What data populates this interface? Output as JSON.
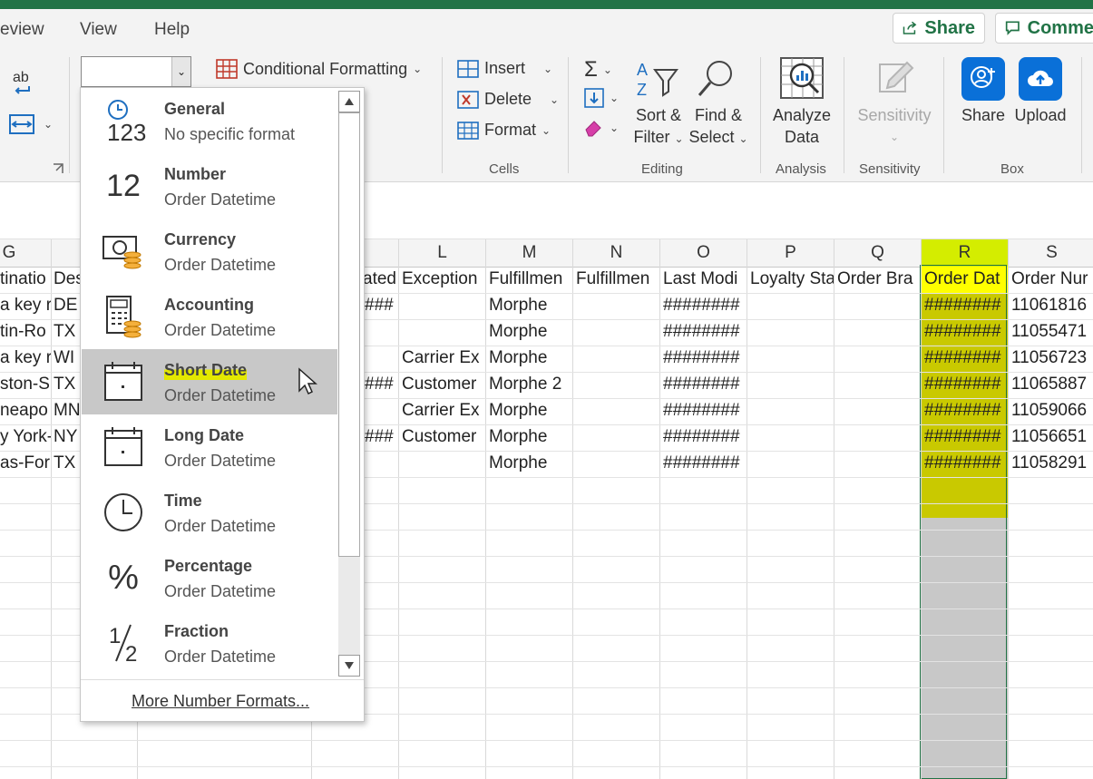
{
  "menu": {
    "review": "eview",
    "view": "View",
    "help": "Help"
  },
  "actions": {
    "share": "Share",
    "comments": "Comme"
  },
  "ribbon": {
    "wrap_icon_text": "ab",
    "conditional_formatting": "Conditional Formatting",
    "cells": {
      "insert": "Insert",
      "delete": "Delete",
      "format": "Format",
      "group": "Cells"
    },
    "editing": {
      "sort_filter_1": "Sort &",
      "sort_filter_2": "Filter",
      "find_select_1": "Find &",
      "find_select_2": "Select",
      "group": "Editing"
    },
    "analysis": {
      "analyze_1": "Analyze",
      "analyze_2": "Data",
      "group": "Analysis"
    },
    "sensitivity": {
      "label": "Sensitivity",
      "group": "Sensitivity"
    },
    "box": {
      "share": "Share",
      "upload": "Upload",
      "group": "Box"
    },
    "number_format_value": ""
  },
  "columns": {
    "G": "G",
    "L": "L",
    "M": "M",
    "N": "N",
    "O": "O",
    "P": "P",
    "Q": "Q",
    "R": "R",
    "S": "S"
  },
  "headers": {
    "g": "tinatio",
    "h": "Des",
    "k": "ated",
    "l": "Exception",
    "m": "Fulfillmen",
    "n": "Fulfillmen",
    "o": "Last Modi",
    "p": "Loyalty Sta",
    "q": "Order Bra",
    "r": "Order Dat",
    "s": "Order Nur"
  },
  "rows": [
    {
      "g": "a key r",
      "h": "DE",
      "k": "###",
      "l": "",
      "m": "Morphe",
      "o": "########",
      "r": "########",
      "s": "11061816"
    },
    {
      "g": "tin-Ro",
      "h": "TX",
      "k": "",
      "l": "",
      "m": "Morphe",
      "o": "########",
      "r": "########",
      "s": "11055471"
    },
    {
      "g": "a key r",
      "h": "WI",
      "k": "",
      "l": "Carrier Ex",
      "m": "Morphe",
      "o": "########",
      "r": "########",
      "s": "11056723"
    },
    {
      "g": "ston-S",
      "h": "TX",
      "k": "###",
      "l": "Customer",
      "m": "Morphe 2",
      "o": "########",
      "r": "########",
      "s": "11065887"
    },
    {
      "g": "neapo",
      "h": "MN",
      "k": "",
      "l": "Carrier Ex",
      "m": "Morphe",
      "o": "########",
      "r": "########",
      "s": "11059066"
    },
    {
      "g": "y York-",
      "h": "NY",
      "k": "###",
      "l": "Customer",
      "m": "Morphe",
      "o": "########",
      "r": "########",
      "s": "11056651"
    },
    {
      "g": "as-For",
      "h": "TX",
      "k": "",
      "l": "",
      "m": "Morphe",
      "o": "########",
      "r": "########",
      "s": "11058291"
    }
  ],
  "number_formats": [
    {
      "title": "General",
      "sub": "No specific format",
      "icon": "clock-123-icon"
    },
    {
      "title": "Number",
      "sub": "Order Datetime",
      "icon": "number-12-icon"
    },
    {
      "title": "Currency",
      "sub": "Order Datetime",
      "icon": "currency-icon"
    },
    {
      "title": "Accounting",
      "sub": " Order Datetime",
      "icon": "calculator-icon"
    },
    {
      "title": "Short Date",
      "sub": "Order Datetime",
      "icon": "calendar-icon"
    },
    {
      "title": "Long Date",
      "sub": "Order Datetime",
      "icon": "calendar-icon"
    },
    {
      "title": "Time",
      "sub": "Order Datetime",
      "icon": "clock-icon"
    },
    {
      "title": "Percentage",
      "sub": "Order Datetime",
      "icon": "percent-icon"
    },
    {
      "title": "Fraction",
      "sub": "Order Datetime",
      "icon": "fraction-icon"
    }
  ],
  "icon_glyphs": {
    "number": "12",
    "percent": "%",
    "fraction_num": "1",
    "fraction_den": "2",
    "general": "123"
  },
  "more_formats": "More Number Formats...",
  "colors": {
    "excel_green": "#217346",
    "highlight": "#e3e800",
    "selected_row": "#c8c8c8",
    "box_blue": "#0a70d8"
  }
}
